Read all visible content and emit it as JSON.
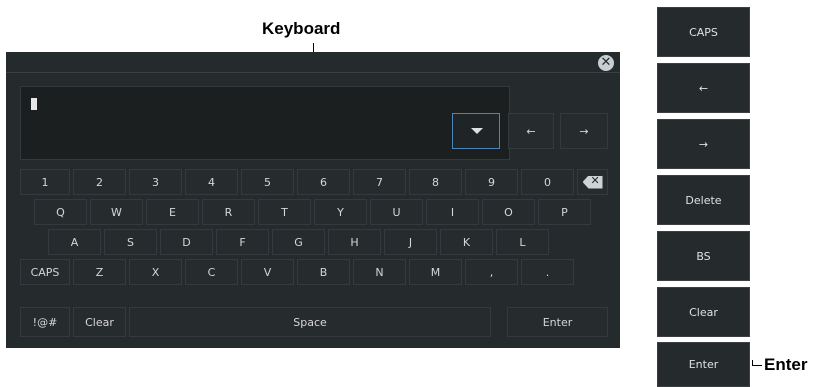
{
  "callouts": {
    "keyboard": "Keyboard",
    "enter": "Enter"
  },
  "keyboard": {
    "close_icon": "close-icon",
    "input_value": "",
    "dropdown_icon": "dropdown-arrow-icon",
    "nav_left": "←",
    "nav_right": "→",
    "row1": [
      "1",
      "2",
      "3",
      "4",
      "5",
      "6",
      "7",
      "8",
      "9",
      "0"
    ],
    "backspace_icon": "backspace-icon",
    "row2": [
      "Q",
      "W",
      "E",
      "R",
      "T",
      "Y",
      "U",
      "I",
      "O",
      "P"
    ],
    "row3": [
      "A",
      "S",
      "D",
      "F",
      "G",
      "H",
      "J",
      "K",
      "L"
    ],
    "row4": [
      "CAPS",
      "Z",
      "X",
      "C",
      "V",
      "B",
      "N",
      "M",
      ",",
      "."
    ],
    "row5": {
      "symbols": "!@#",
      "clear": "Clear",
      "space": "Space",
      "enter": "Enter"
    }
  },
  "side_panel": {
    "caps": "CAPS",
    "left": "←",
    "right": "→",
    "delete": "Delete",
    "bs": "BS",
    "clear": "Clear",
    "enter": "Enter"
  }
}
